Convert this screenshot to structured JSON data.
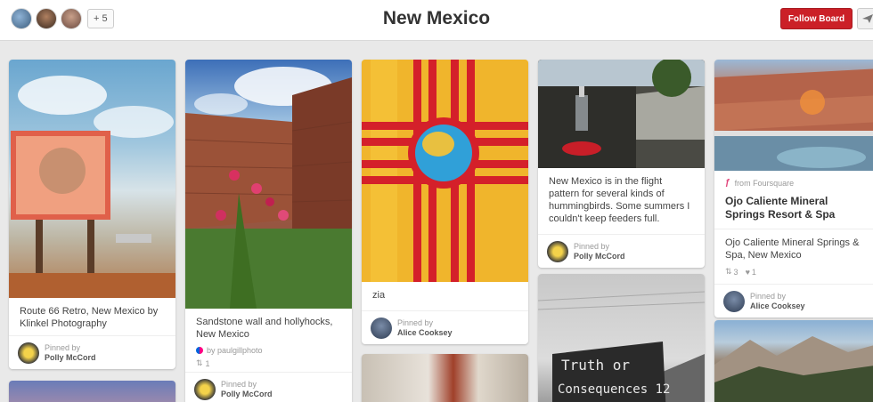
{
  "header": {
    "title": "New Mexico",
    "more_count": "+ 5",
    "follow_label": "Follow Board"
  },
  "pins": [
    {
      "description": "Route 66 Retro, New Mexico by Klinkel Photography",
      "pinned_by_label": "Pinned by",
      "pinner": "Polly McCord"
    },
    {
      "description": "Sandstone wall and hollyhocks, New Mexico",
      "source": "by paulgillphoto",
      "repin_count": "1",
      "pinned_by_label": "Pinned by",
      "pinner": "Polly McCord"
    },
    {
      "description": "zia",
      "pinned_by_label": "Pinned by",
      "pinner": "Alice Cooksey"
    },
    {
      "description": "New Mexico is in the flight pattern for several kinds of hummingbirds. Some summers I couldn't keep feeders full.",
      "pinned_by_label": "Pinned by",
      "pinner": "Polly McCord"
    },
    {
      "source": "from Foursquare",
      "place_title": "Ojo Caliente Mineral Springs Resort & Spa",
      "description": "Ojo Caliente Mineral Springs & Spa, New Mexico",
      "repin_count": "3",
      "like_count": "1",
      "pinned_by_label": "Pinned by",
      "pinner": "Alice Cooksey"
    }
  ],
  "sign_text": {
    "line1": "Truth or",
    "line2": "Consequences 12"
  },
  "colors": {
    "follow": "#cb2027",
    "background": "#e9e9e9"
  }
}
